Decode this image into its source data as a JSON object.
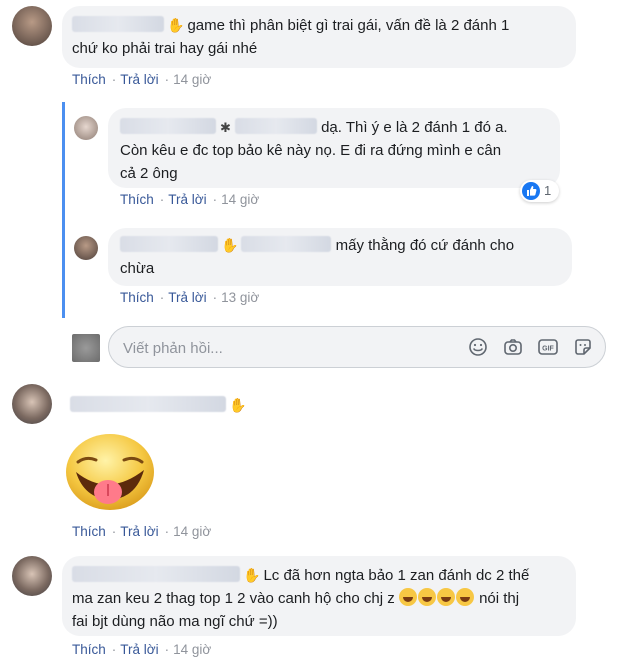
{
  "actions": {
    "like": "Thích",
    "reply": "Trả lời"
  },
  "comments": [
    {
      "text_line1": "game thì phân biệt gì trai gái, vấn đề là 2 đánh 1",
      "text_line2": "chứ ko phải trai hay gái nhé",
      "time": "14 giờ"
    },
    {
      "text_line1": "dạ. Thì ý e là 2 đánh 1 đó a.",
      "text_line2": "Còn kêu e đc top bảo kê này nọ. E đi ra đứng mình e cân",
      "text_line3": "cả 2 ông",
      "time": "14 giờ",
      "reaction_count": "1"
    },
    {
      "text_line1": "mấy thằng đó cứ đánh cho",
      "text_line2": "chừa",
      "time": "13 giờ"
    },
    {
      "sticker": "tongue-out-sticker",
      "time": "14 giờ"
    },
    {
      "text_line1": "Lc đã hơn ngta bảo 1 zan đánh dc 2 thế",
      "text_line2a": "ma zan keu 2 thag top 1 2 vào canh hộ cho chj z",
      "text_line2b": "nói thj",
      "text_line3": "fai bjt dùng não ma ngĩ chứ =))",
      "time": "14 giờ"
    }
  ],
  "reply_box": {
    "placeholder": "Viết phản hồi..."
  },
  "colors": {
    "link": "#385898",
    "bubble": "#f2f3f5",
    "thread": "#4b8ff0",
    "like_blue": "#1877f2"
  },
  "icons": [
    "wave-hand-icon",
    "smile-icon",
    "camera-icon",
    "gif-icon",
    "sticker-icon",
    "like-icon",
    "laughing-emoji-icon"
  ]
}
